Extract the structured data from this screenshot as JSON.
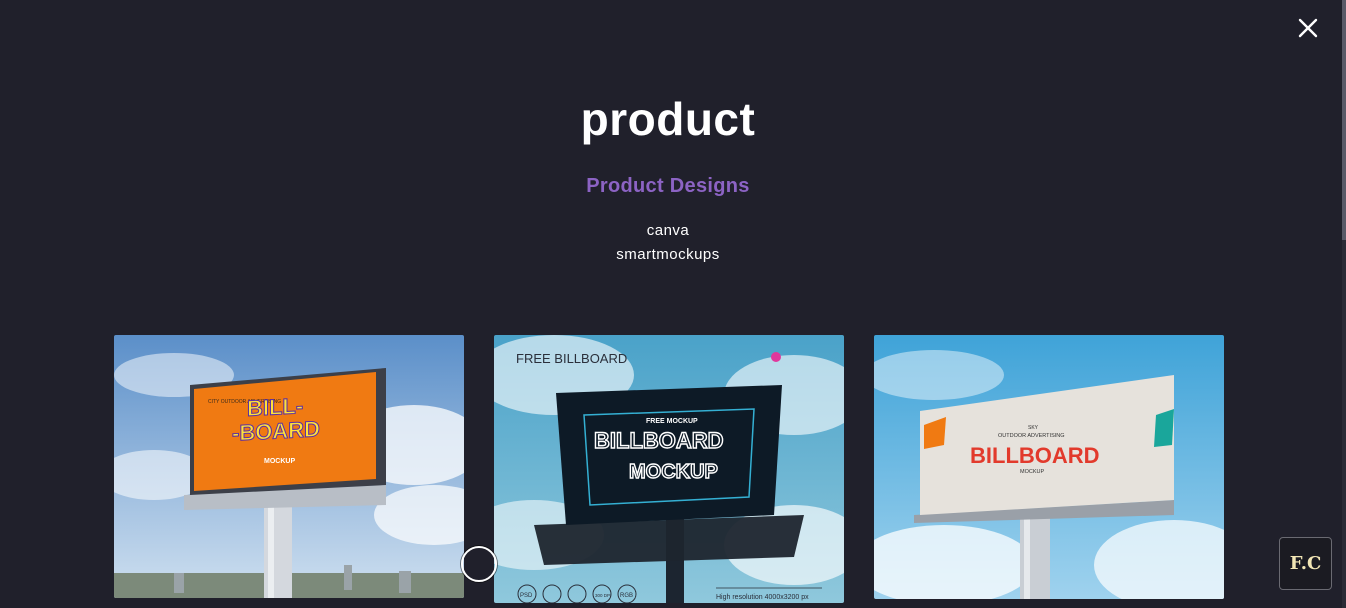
{
  "project": {
    "title": "product",
    "subtitle": "Product Designs",
    "tools": [
      "canva",
      "smartmockups"
    ]
  },
  "gallery": [
    {
      "image_name": "orange-billboard-mockup",
      "lines": [
        "CITY OUTDOOR ADVERTISING",
        "BILL-",
        "-BOARD",
        "MOCKUP"
      ]
    },
    {
      "image_name": "dark-billboard-mockup",
      "corner_title": "FREE BILLBOARD",
      "lines": [
        "FREE MOCKUP",
        "BILLBOARD",
        "MOCKUP"
      ],
      "footer": "High resolution 4000x3200 px",
      "badges": [
        "PSD",
        "300 DPI",
        "RGB"
      ]
    },
    {
      "image_name": "white-billboard-mockup",
      "lines": [
        "SKY",
        "OUTDOOR ADVERTISING",
        "BILLBOARD",
        "MOCKUP"
      ]
    }
  ],
  "brand_badge": "F.C",
  "icons": {
    "close": "close-icon",
    "cursor": "cursor-ring"
  },
  "colors": {
    "background": "#20202b",
    "accent": "#8c63c4",
    "text": "#ffffff"
  }
}
